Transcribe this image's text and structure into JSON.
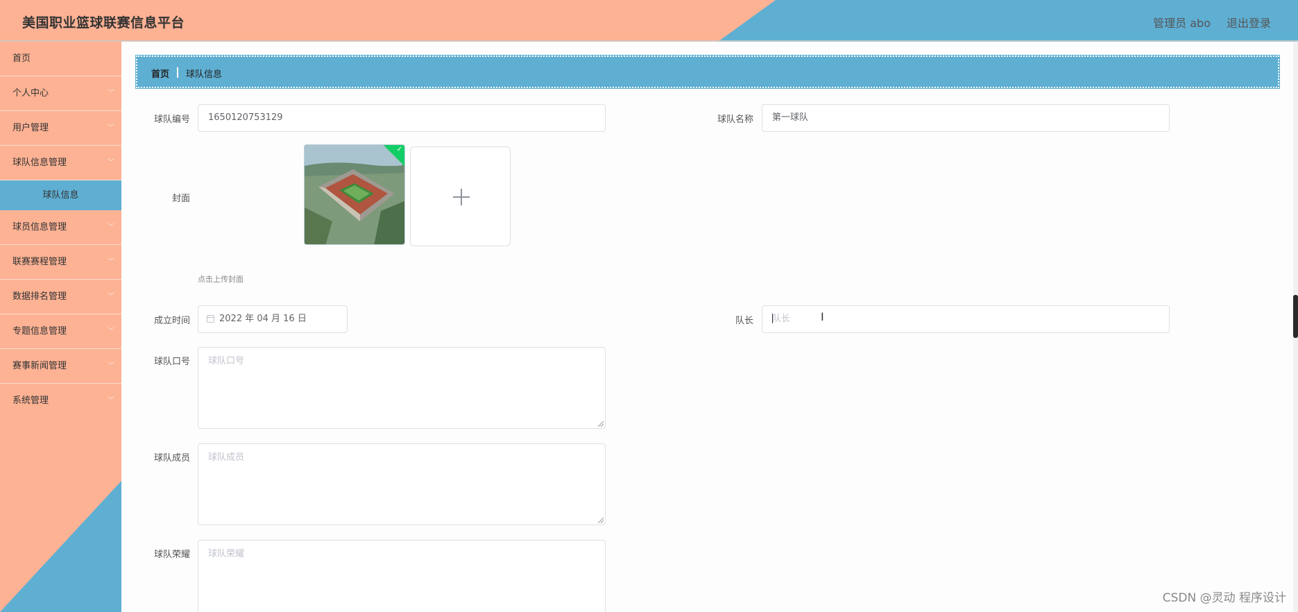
{
  "header": {
    "title": "美国职业篮球联赛信息平台",
    "admin": "管理员 abo",
    "logout": "退出登录"
  },
  "sidebar": {
    "items": [
      {
        "label": "首页"
      },
      {
        "label": "个人中心"
      },
      {
        "label": "用户管理"
      },
      {
        "label": "球队信息管理"
      },
      {
        "label": "球员信息管理"
      },
      {
        "label": "联赛赛程管理"
      },
      {
        "label": "数据排名管理"
      },
      {
        "label": "专题信息管理"
      },
      {
        "label": "赛事新闻管理"
      },
      {
        "label": "系统管理"
      }
    ],
    "active_sub": "球队信息",
    "chevron": "chevron-down-icon"
  },
  "breadcrumb": {
    "home": "首页",
    "current": "球队信息"
  },
  "form": {
    "team_no_label": "球队编号",
    "team_no_value": "1650120753129",
    "team_name_label": "球队名称",
    "team_name_value": "第一球队",
    "cover_label": "封面",
    "cover_hint": "点击上传封面",
    "founded_label": "成立时间",
    "founded_value": "2022 年 04 月 16 日",
    "captain_label": "队长",
    "captain_placeholder": "队长",
    "slogan_label": "球队口号",
    "slogan_placeholder": "球队口号",
    "members_label": "球队成员",
    "members_placeholder": "球队成员",
    "honors_label": "球队荣耀",
    "honors_placeholder": "球队荣耀"
  },
  "watermark": "CSDN @灵动 程序设计",
  "colors": {
    "salmon": "#fdb294",
    "blue": "#5fafd3",
    "success": "#13ce66"
  }
}
